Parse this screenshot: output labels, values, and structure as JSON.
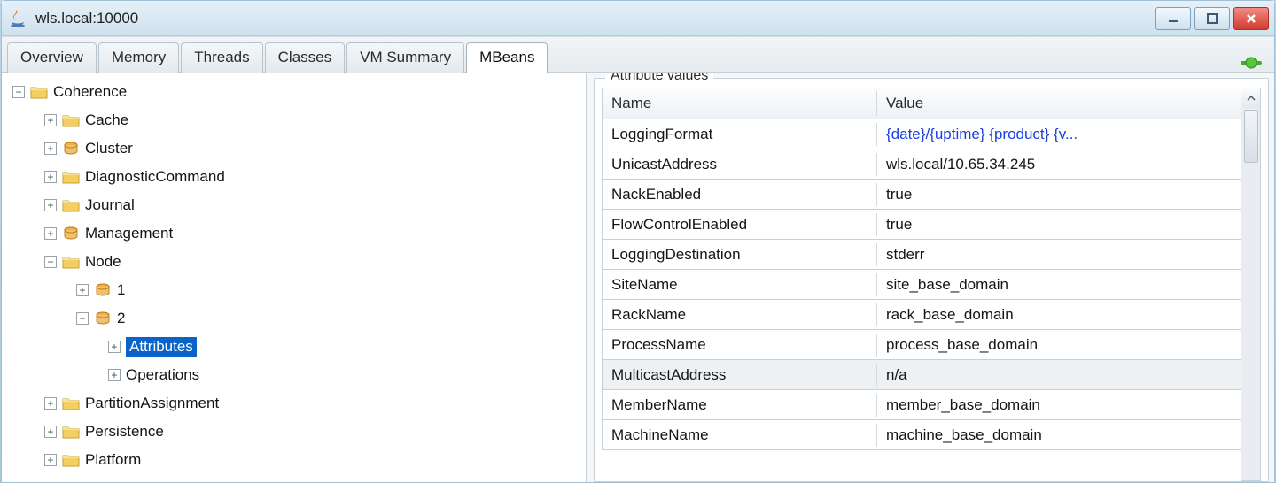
{
  "window": {
    "title": "wls.local:10000"
  },
  "tabs": [
    {
      "label": "Overview"
    },
    {
      "label": "Memory"
    },
    {
      "label": "Threads"
    },
    {
      "label": "Classes"
    },
    {
      "label": "VM Summary"
    },
    {
      "label": "MBeans"
    }
  ],
  "active_tab": "MBeans",
  "tree": {
    "root": "Coherence",
    "root_expanded": "−",
    "items": [
      {
        "label": "Cache",
        "icon": "folder",
        "exp": "+"
      },
      {
        "label": "Cluster",
        "icon": "bean",
        "exp": "+"
      },
      {
        "label": "DiagnosticCommand",
        "icon": "folder",
        "exp": "+"
      },
      {
        "label": "Journal",
        "icon": "folder",
        "exp": "+"
      },
      {
        "label": "Management",
        "icon": "bean",
        "exp": "+"
      },
      {
        "label": "Node",
        "icon": "folder",
        "exp": "−"
      },
      {
        "label": "PartitionAssignment",
        "icon": "folder",
        "exp": "+"
      },
      {
        "label": "Persistence",
        "icon": "folder",
        "exp": "+"
      },
      {
        "label": "Platform",
        "icon": "folder",
        "exp": "+"
      }
    ],
    "node_children": [
      {
        "label": "1",
        "icon": "bean",
        "exp": "+"
      },
      {
        "label": "2",
        "icon": "bean",
        "exp": "−"
      }
    ],
    "node2_children": [
      {
        "label": "Attributes",
        "exp": "+",
        "selected": true
      },
      {
        "label": "Operations",
        "exp": "+",
        "selected": false
      }
    ]
  },
  "attributes": {
    "title": "Attribute values",
    "columns": {
      "name": "Name",
      "value": "Value"
    },
    "rows": [
      {
        "name": "LoggingFormat",
        "value": "{date}/{uptime} {product} {v...",
        "link": true
      },
      {
        "name": "UnicastAddress",
        "value": "wls.local/10.65.34.245"
      },
      {
        "name": "NackEnabled",
        "value": "true"
      },
      {
        "name": "FlowControlEnabled",
        "value": "true"
      },
      {
        "name": "LoggingDestination",
        "value": "stderr"
      },
      {
        "name": "SiteName",
        "value": "site_base_domain"
      },
      {
        "name": "RackName",
        "value": "rack_base_domain"
      },
      {
        "name": "ProcessName",
        "value": "process_base_domain"
      },
      {
        "name": "MulticastAddress",
        "value": "n/a",
        "selected": true
      },
      {
        "name": "MemberName",
        "value": "member_base_domain"
      },
      {
        "name": "MachineName",
        "value": "machine_base_domain"
      }
    ]
  }
}
